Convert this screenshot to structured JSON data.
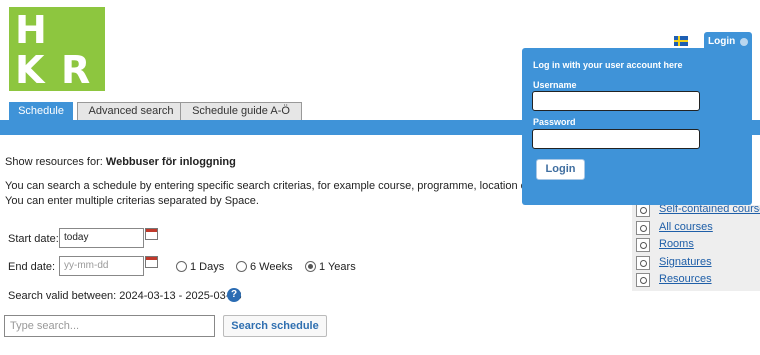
{
  "logo": {
    "letters": [
      "H",
      "K",
      "R"
    ]
  },
  "tabs": [
    {
      "label": "Schedule"
    },
    {
      "label": "Advanced search"
    },
    {
      "label": "Schedule guide A-Ö"
    }
  ],
  "login": {
    "tab_label": "Login",
    "header": "Log in with your user account here",
    "username_label": "Username",
    "password_label": "Password",
    "button_label": "Login"
  },
  "main": {
    "show_prefix": "Show resources for:",
    "show_user": "Webbuser för inloggning",
    "intro_line1": "You can search a schedule by entering specific search criterias, for example course, programme, location or signatur",
    "intro_line2": "You can enter multiple criterias separated by Space.",
    "start_label": "Start date:",
    "start_value": "today",
    "end_label": "End date:",
    "end_placeholder": "yy-mm-dd",
    "radios": [
      {
        "label": "1 Days",
        "selected": false
      },
      {
        "label": "6 Weeks",
        "selected": false
      },
      {
        "label": "1 Years",
        "selected": true
      }
    ],
    "valid_prefix": "Search valid between:",
    "valid_range": "2024-03-13 - 2025-03-13",
    "help_symbol": "?",
    "search_placeholder": "Type search...",
    "search_button": "Search schedule"
  },
  "sidebar": {
    "items": [
      {
        "label": "Self-contained courses"
      },
      {
        "label": "All courses"
      },
      {
        "label": "Rooms"
      },
      {
        "label": "Signatures"
      },
      {
        "label": "Resources"
      }
    ]
  },
  "colors": {
    "brand_green": "#8dc63f",
    "accent_blue": "#3f93d8",
    "link": "#1f5fa8"
  },
  "icons": [
    "flag-sweden-icon",
    "chevron-down-icon",
    "calendar-icon",
    "help-icon",
    "magnifier-doc-icon"
  ]
}
